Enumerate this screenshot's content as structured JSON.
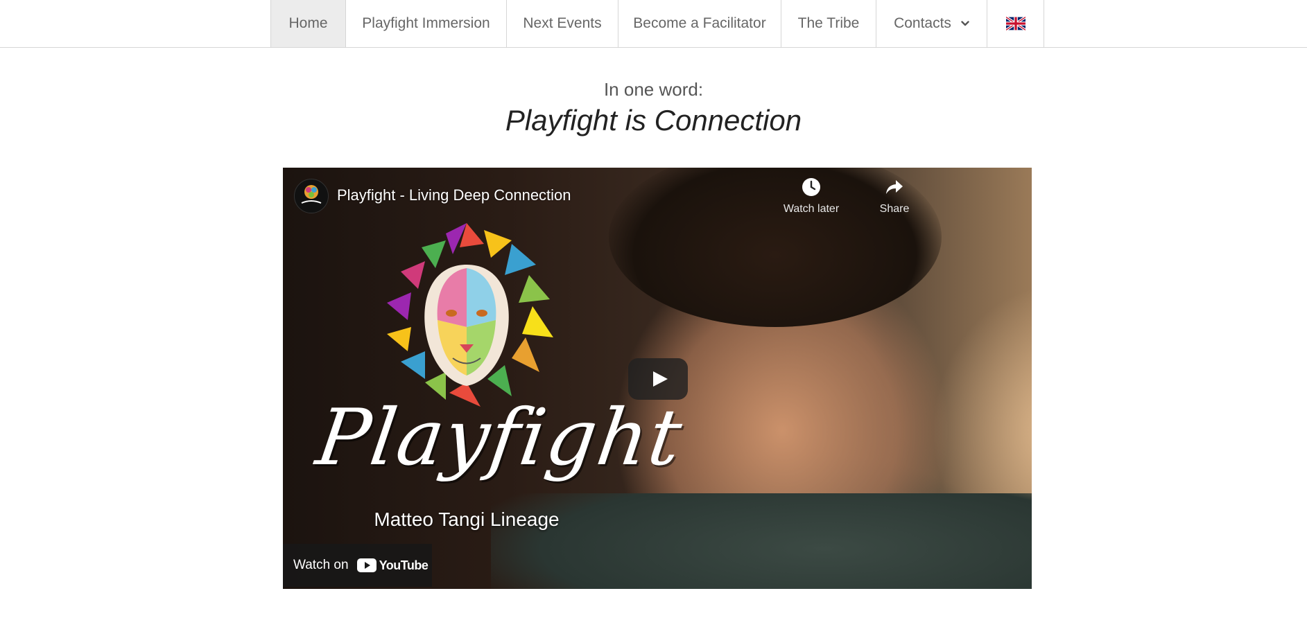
{
  "nav": {
    "items": [
      {
        "label": "Home",
        "active": true
      },
      {
        "label": "Playfight Immersion"
      },
      {
        "label": "Next Events"
      },
      {
        "label": "Become a Facilitator"
      },
      {
        "label": "The Tribe"
      },
      {
        "label": "Contacts",
        "has_dropdown": true
      }
    ],
    "language_flag": "uk-flag-icon"
  },
  "intro": {
    "subheading": "In one word:",
    "heading": "Playfight is Connection"
  },
  "video": {
    "title": "Playfight - Living Deep Connection",
    "watch_later_label": "Watch later",
    "share_label": "Share",
    "thumbnail_script_text": "Playfight",
    "thumbnail_subtitle": "Matteo Tangi Lineage",
    "watch_on_label": "Watch on",
    "youtube_label": "YouTube"
  },
  "colors": {
    "nav_border": "#d6d6d6",
    "nav_active_bg": "#ececec",
    "youtube_red": "#ff0000"
  }
}
